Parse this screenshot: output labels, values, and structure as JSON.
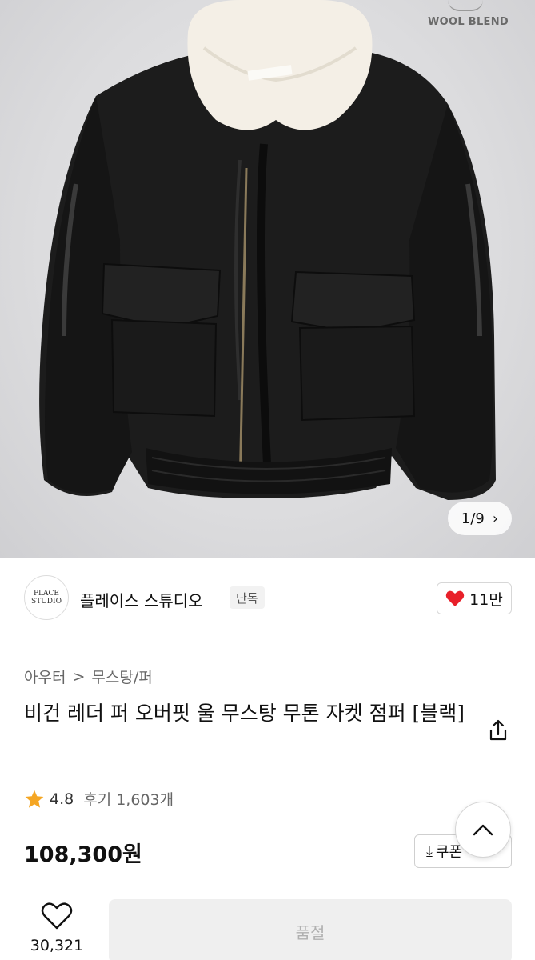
{
  "image": {
    "badge": "WOOL BLEND",
    "counter": "1/9"
  },
  "brand": {
    "logo_text": "PLACE STUDIO",
    "name": "플레이스 스튜디오",
    "tag": "단독",
    "likes": "11만"
  },
  "breadcrumb": {
    "parent": "아우터",
    "separator": ">",
    "child": "무스탕/퍼"
  },
  "product": {
    "title": "비건 레더 퍼 오버핏 울 무스탕 무톤 자켓 점퍼 [블랙]",
    "rating": "4.8",
    "review_label": "후기 1,603개",
    "price": "108,300원"
  },
  "coupon": {
    "label": "쿠폰"
  },
  "bottom_bar": {
    "wish_count": "30,321",
    "soldout_label": "품절"
  },
  "colors": {
    "heart": "#e8202a",
    "star": "#f5a623",
    "soldout_bg": "#efefef"
  }
}
